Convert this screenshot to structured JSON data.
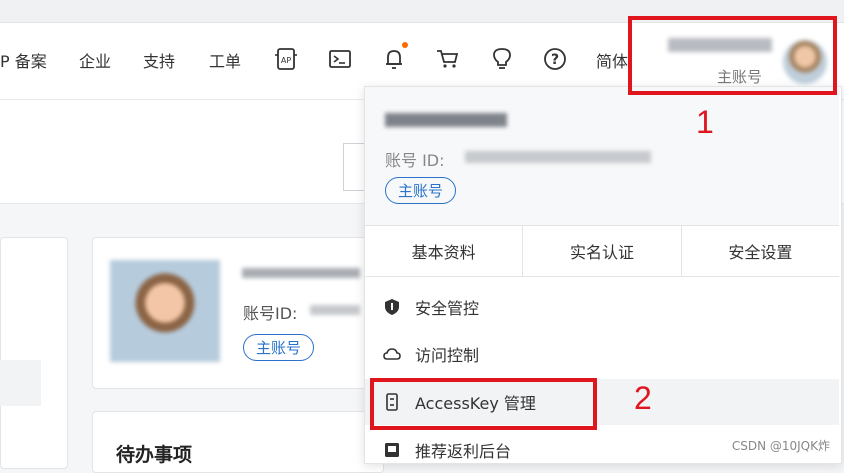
{
  "nav": {
    "items": [
      "P 备案",
      "企业",
      "支持",
      "工单"
    ],
    "lang": "简体",
    "icons": [
      "app-icon",
      "terminal-icon",
      "bell-icon",
      "cart-icon",
      "lightbulb-icon",
      "help-icon"
    ]
  },
  "account": {
    "role": "主账号"
  },
  "profile_card": {
    "id_label": "账号ID:",
    "badge": "主账号"
  },
  "todo": {
    "title": "待办事项"
  },
  "dropdown": {
    "id_label": "账号 ID:",
    "badge": "主账号",
    "tabs": [
      "基本资料",
      "实名认证",
      "安全设置"
    ],
    "menu": [
      {
        "label": "安全管控",
        "icon": "shield-icon"
      },
      {
        "label": "访问控制",
        "icon": "cloud-icon"
      },
      {
        "label": "AccessKey 管理",
        "icon": "key-icon"
      },
      {
        "label": "推荐返利后台",
        "icon": "monitor-icon"
      }
    ]
  },
  "annotations": [
    "1",
    "2"
  ],
  "watermark": "CSDN @10JQK炸",
  "colors": {
    "accent": "#2a73c9",
    "highlight": "#e0161e",
    "notify_dot": "#ff6a00"
  }
}
